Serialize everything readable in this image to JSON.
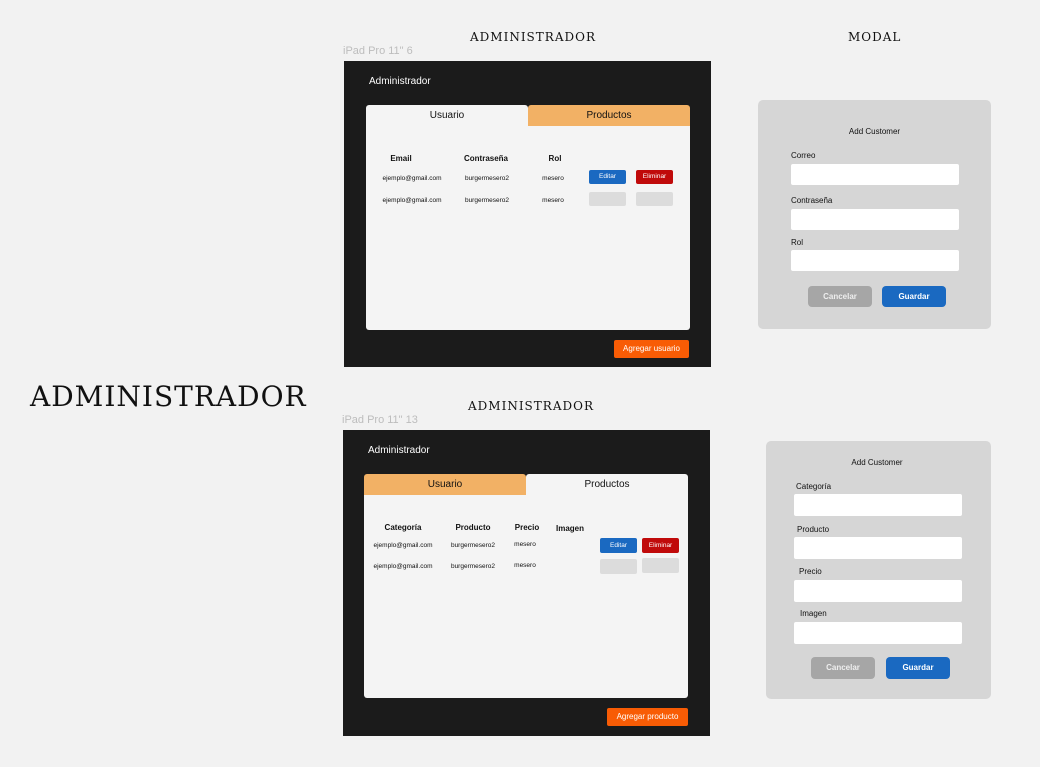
{
  "page_heading": "ADMINISTRADOR",
  "section1": {
    "heading": "ADMINISTRADOR",
    "frame_label": "iPad Pro 11\"  6",
    "app_title": "Administrador",
    "tabs": [
      "Usuario",
      "Productos"
    ],
    "columns": [
      "Email",
      "Contraseña",
      "Rol"
    ],
    "rows": [
      {
        "email": "ejemplo@gmail.com",
        "password": "burgermesero2",
        "role": "mesero",
        "edit": "Editar",
        "delete": "Eliminar"
      },
      {
        "email": "ejemplo@gmail.com",
        "password": "burgermesero2",
        "role": "mesero"
      }
    ],
    "add_button": "Agregar usuario"
  },
  "modal1": {
    "heading": "MODAL",
    "title": "Add Customer",
    "fields": [
      "Correo",
      "Contraseña",
      "Rol"
    ],
    "cancel": "Cancelar",
    "save": "Guardar"
  },
  "section2": {
    "heading": "ADMINISTRADOR",
    "frame_label": "iPad Pro 11\"  13",
    "app_title": "Administrador",
    "tabs": [
      "Usuario",
      "Productos"
    ],
    "columns": [
      "Categoría",
      "Producto",
      "Precio",
      "Imagen"
    ],
    "rows": [
      {
        "category": "ejemplo@gmail.com",
        "product": "burgermesero2",
        "price": "mesero",
        "edit": "Editar",
        "delete": "Eliminar"
      },
      {
        "category": "ejemplo@gmail.com",
        "product": "burgermesero2",
        "price": "mesero"
      }
    ],
    "add_button": "Agregar producto"
  },
  "modal2": {
    "title": "Add Customer",
    "fields": [
      "Categoría",
      "Producto",
      "Precio",
      "Imagen"
    ],
    "cancel": "Cancelar",
    "save": "Guardar"
  },
  "colors": {
    "frame": "#1b1b1b",
    "tab_inactive": "#f2b165",
    "edit_button": "#1a69c1",
    "delete_button": "#c00a0a",
    "add_button": "#f85c05",
    "modal_bg": "#d6d6d6"
  }
}
